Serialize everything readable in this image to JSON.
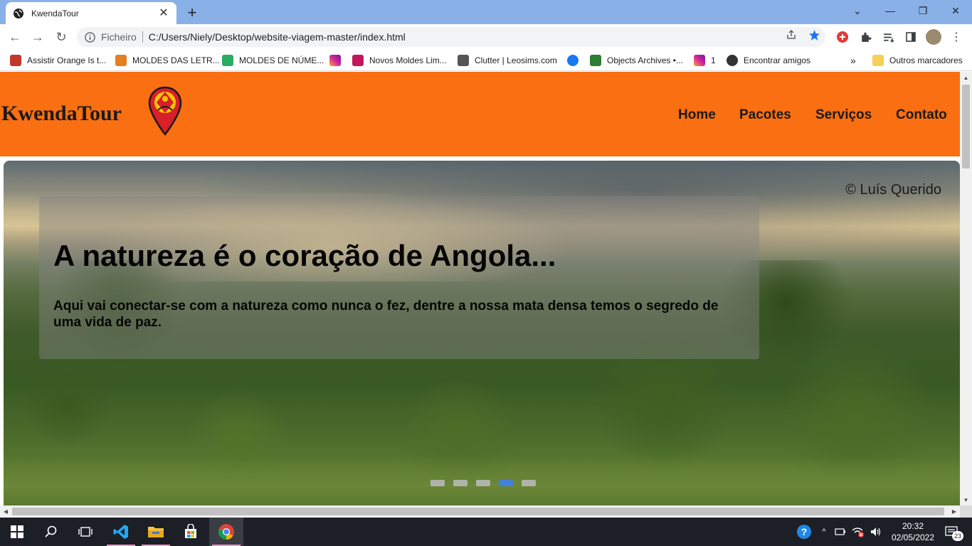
{
  "browser": {
    "tab_title": "KwendaTour",
    "omnibox_scheme": "Ficheiro",
    "omnibox_url": "C:/Users/Niely/Desktop/website-viagem-master/index.html",
    "bookmarks": [
      {
        "label": "Assistir Orange Is t...",
        "icon_color": "#c0392b"
      },
      {
        "label": "MOLDES DAS LETR...",
        "icon_color": "#e67e22"
      },
      {
        "label": "MOLDES DE NÚME...",
        "icon_color": "#27ae60"
      },
      {
        "label": "",
        "icon_color": "#d6249f"
      },
      {
        "label": "Novos Moldes Lim...",
        "icon_color": "#c2185b"
      },
      {
        "label": "Clutter | Leosims.com",
        "icon_color": "#555555"
      },
      {
        "label": "",
        "icon_color": "#1877f2"
      },
      {
        "label": "Objects Archives •...",
        "icon_color": "#2e7d32"
      },
      {
        "label": "1",
        "icon_color": "#d6249f"
      },
      {
        "label": "Encontrar amigos",
        "icon_color": "#333333"
      }
    ],
    "bookmarks_more": "»",
    "other_bookmarks": "Outros marcadores"
  },
  "site": {
    "logo_text": "KwendaTour",
    "nav": [
      "Home",
      "Pacotes",
      "Serviços",
      "Contato"
    ],
    "hero": {
      "credit": "© Luís Querido",
      "heading": "A natureza é o coração de Angola...",
      "text": "Aqui vai conectar-se com a natureza como nunca o fez, dentre a nossa mata densa temos o segredo de uma vida de paz.",
      "slides_total": 5,
      "active_slide": 4
    }
  },
  "taskbar": {
    "time": "20:32",
    "date": "02/05/2022",
    "notifications": "23"
  },
  "colors": {
    "header_bg": "#f96f12",
    "active_dot": "#3d7ff0",
    "tab_strip": "#8ab0e8"
  }
}
